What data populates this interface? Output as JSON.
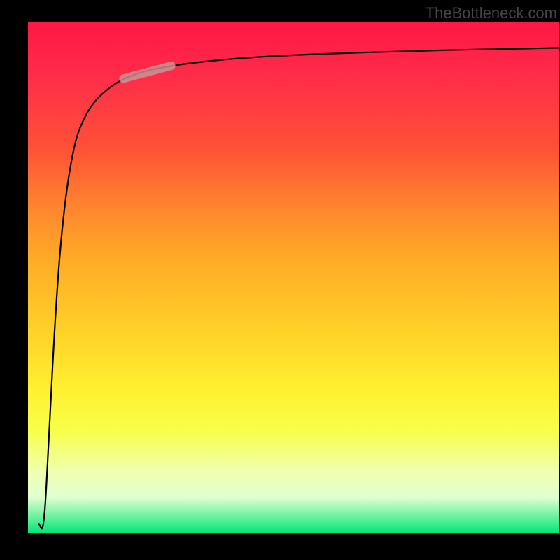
{
  "attribution": "TheBottleneck.com",
  "chart_data": {
    "type": "line",
    "title": "",
    "xlabel": "",
    "ylabel": "",
    "xlim": [
      0,
      100
    ],
    "ylim": [
      0,
      100
    ],
    "grid": false,
    "x": [
      2,
      3,
      4,
      5,
      6,
      7,
      8,
      9,
      10,
      12,
      15,
      18,
      22,
      27,
      32,
      40,
      50,
      60,
      70,
      80,
      90,
      100
    ],
    "values": [
      2,
      0,
      20,
      40,
      55,
      65,
      72,
      77,
      80,
      84,
      87,
      89,
      90.5,
      91.5,
      92.2,
      93,
      93.6,
      94,
      94.3,
      94.6,
      94.8,
      95
    ],
    "highlight_band": {
      "x_start": 18,
      "x_end": 27,
      "y_start": 89,
      "y_end": 91.5
    },
    "colors": {
      "curve": "#000000",
      "highlight": "#c99a9a",
      "gradient_top": "#ff1744",
      "gradient_mid1": "#ffa726",
      "gradient_mid2": "#fff030",
      "gradient_bottom": "#00e676",
      "frame": "#000000"
    }
  }
}
